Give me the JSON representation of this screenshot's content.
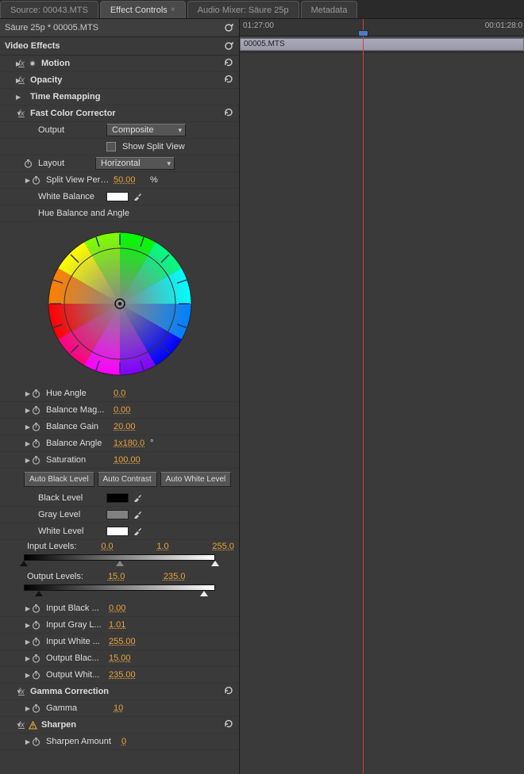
{
  "tabs": {
    "source": "Source: 00043.MTS",
    "effect_controls": "Effect Controls",
    "audio_mixer": "Audio Mixer: Säure 25p",
    "metadata": "Metadata"
  },
  "sequence_title": "Säure 25p * 00005.MTS",
  "video_effects_label": "Video Effects",
  "timeline": {
    "tc1": "01:27:00",
    "tc2": "00:01:28:0",
    "clip": "00005.MTS"
  },
  "effects": {
    "motion": "Motion",
    "opacity": "Opacity",
    "time_remapping": "Time Remapping",
    "fcc": {
      "title": "Fast Color Corrector",
      "output_label": "Output",
      "output_value": "Composite",
      "show_split_label": "Show Split View",
      "layout_label": "Layout",
      "layout_value": "Horizontal",
      "split_pct_label": "Split View Perc...",
      "split_pct_value": "50.00",
      "split_pct_unit": "%",
      "white_balance_label": "White Balance",
      "hue_balance_angle_label": "Hue Balance and Angle",
      "hue_angle_label": "Hue Angle",
      "hue_angle_value": "0.0",
      "balance_mag_label": "Balance Mag...",
      "balance_mag_value": "0.00",
      "balance_gain_label": "Balance Gain",
      "balance_gain_value": "20.00",
      "balance_angle_label": "Balance Angle",
      "balance_angle_value": "1x180.0",
      "balance_angle_unit": "°",
      "saturation_label": "Saturation",
      "saturation_value": "100.00",
      "auto_black": "Auto Black Level",
      "auto_contrast": "Auto Contrast",
      "auto_white": "Auto White Level",
      "black_level_label": "Black Level",
      "gray_level_label": "Gray Level",
      "white_level_label": "White Level",
      "input_levels_label": "Input Levels:",
      "input_levels_v1": "0.0",
      "input_levels_v2": "1.0",
      "input_levels_v3": "255.0",
      "output_levels_label": "Output Levels:",
      "output_levels_v1": "15.0",
      "output_levels_v2": "235.0",
      "input_black_label": "Input Black ...",
      "input_black_value": "0.00",
      "input_gray_label": "Input Gray L...",
      "input_gray_value": "1.01",
      "input_white_label": "Input White ...",
      "input_white_value": "255.00",
      "output_black_label": "Output Blac...",
      "output_black_value": "15.00",
      "output_white_label": "Output Whit...",
      "output_white_value": "235.00"
    },
    "gamma": {
      "title": "Gamma Correction",
      "param_label": "Gamma",
      "param_value": "10"
    },
    "sharpen": {
      "title": "Sharpen",
      "param_label": "Sharpen Amount",
      "param_value": "0"
    }
  },
  "colors": {
    "white": "#ffffff",
    "black": "#000000",
    "gray": "#808080",
    "accent": "#e8a33d"
  }
}
